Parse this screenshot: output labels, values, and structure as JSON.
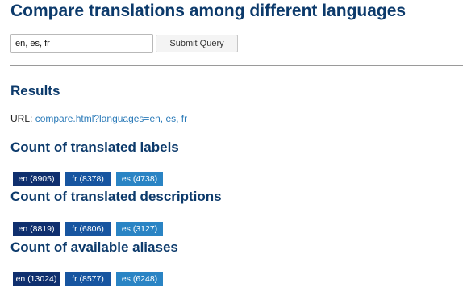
{
  "page": {
    "title": "Compare translations among different languages"
  },
  "form": {
    "input_value": "en, es, fr",
    "submit_label": "Submit Query"
  },
  "results": {
    "heading": "Results",
    "url_label": "URL:",
    "url_link": "compare.html?languages=en, es, fr"
  },
  "sections": {
    "labels": {
      "heading": "Count of translated labels",
      "badges": [
        "en (8905)",
        "fr (8378)",
        "es (4738)"
      ]
    },
    "descriptions": {
      "heading": "Count of translated descriptions",
      "badges": [
        "en (8819)",
        "fr (6806)",
        "es (3127)"
      ]
    },
    "aliases": {
      "heading": "Count of available aliases",
      "badges": [
        "en (13024)",
        "fr (8577)",
        "es (6248)"
      ]
    }
  },
  "colors": {
    "heading": "#0c3a6b",
    "badge_en": "#0f2f6e",
    "badge_fr": "#1755a0",
    "badge_es": "#2a84c4",
    "link": "#2a7ab8"
  }
}
